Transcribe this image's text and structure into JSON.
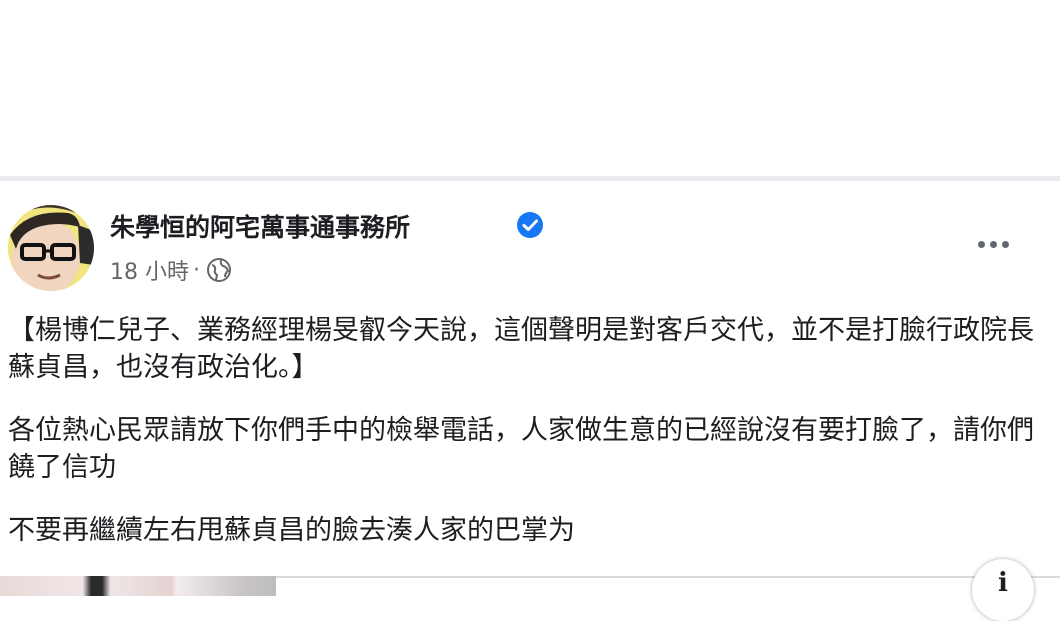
{
  "post": {
    "page_name": "朱學恒的阿宅萬事通事務所",
    "time": "18 小時",
    "separator": "·",
    "visibility_icon": "globe-icon",
    "verified_icon": "verified-badge-icon",
    "more_icon": "more-options-icon",
    "paragraphs": [
      "【楊博仁兒子、業務經理楊旻叡今天說，這個聲明是對客戶交代，並不是打臉行政院長蘇貞昌，也沒有政治化。】",
      "各位熱心民眾請放下你們手中的檢舉電話，人家做生意的已經說沒有要打臉了，請你們饒了信功",
      "不要再繼續左右甩蘇貞昌的臉去湊人家的巴掌为"
    ]
  },
  "info_button": {
    "icon": "info-icon",
    "glyph": "i"
  },
  "colors": {
    "text": "#1c1e21",
    "secondary": "#65676b",
    "verified": "#1877f2",
    "divider": "#e9eaed"
  }
}
